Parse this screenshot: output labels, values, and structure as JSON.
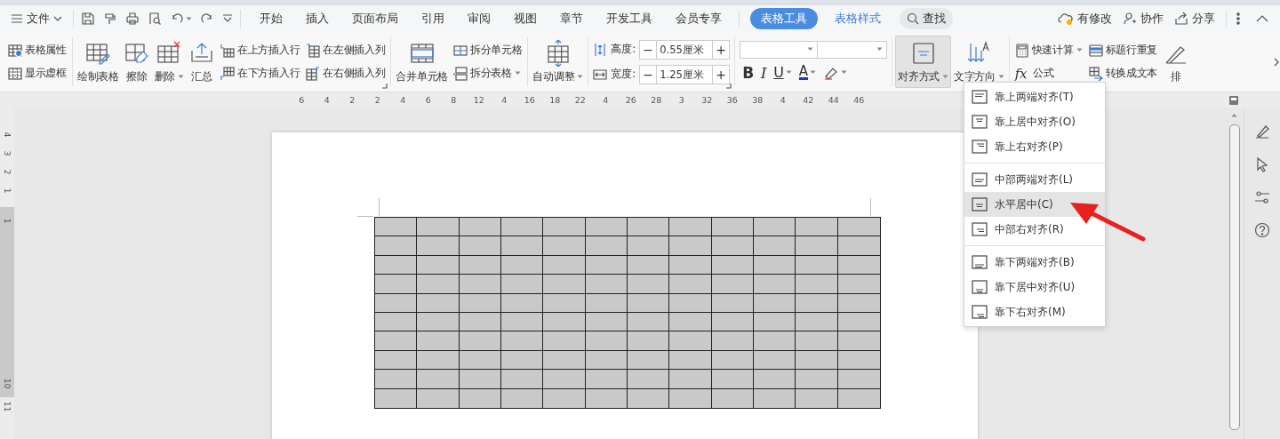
{
  "menu_bar": {
    "file_menu": {
      "label": "文件"
    },
    "tabs": [
      {
        "label": "开始",
        "kind": "normal",
        "selected": false
      },
      {
        "label": "插入",
        "kind": "normal",
        "selected": false
      },
      {
        "label": "页面布局",
        "kind": "normal",
        "selected": false
      },
      {
        "label": "引用",
        "kind": "normal",
        "selected": false
      },
      {
        "label": "审阅",
        "kind": "normal",
        "selected": false
      },
      {
        "label": "视图",
        "kind": "normal",
        "selected": false
      },
      {
        "label": "章节",
        "kind": "normal",
        "selected": false
      },
      {
        "label": "开发工具",
        "kind": "normal",
        "selected": false
      },
      {
        "label": "会员专享",
        "kind": "normal",
        "selected": false
      },
      {
        "label": "表格工具",
        "kind": "context",
        "selected": true
      },
      {
        "label": "表格样式",
        "kind": "context",
        "selected": false
      }
    ],
    "search": {
      "label": "查找"
    },
    "actions": [
      {
        "label": "有修改"
      },
      {
        "label": "协作"
      },
      {
        "label": "分享"
      }
    ]
  },
  "ribbon": {
    "groups": [
      {
        "launcher": false,
        "columns": [
          {
            "kind": "stack",
            "items": [
              {
                "label": "表格属性",
                "dropdown": false
              },
              {
                "label": "显示虚框",
                "dropdown": false
              }
            ]
          }
        ]
      },
      {
        "launcher": true,
        "columns": [
          {
            "kind": "large",
            "label": "绘制表格",
            "dropdown": false,
            "pressed": false
          },
          {
            "kind": "large",
            "label": "擦除",
            "dropdown": false,
            "pressed": false
          },
          {
            "kind": "large",
            "label": "删除",
            "dropdown": true,
            "pressed": false
          },
          {
            "kind": "large",
            "label": "汇总",
            "dropdown": false,
            "pressed": false
          },
          {
            "kind": "stack",
            "items": [
              {
                "label": "在上方插入行",
                "dropdown": false
              },
              {
                "label": "在下方插入行",
                "dropdown": false
              }
            ]
          },
          {
            "kind": "stack",
            "items": [
              {
                "label": "在左侧插入列",
                "dropdown": false
              },
              {
                "label": "在右侧插入列",
                "dropdown": false
              }
            ]
          }
        ]
      },
      {
        "launcher": false,
        "columns": [
          {
            "kind": "large",
            "label": "合并单元格",
            "dropdown": false,
            "pressed": false
          },
          {
            "kind": "stack",
            "items": [
              {
                "label": "拆分单元格",
                "dropdown": false
              },
              {
                "label": "拆分表格",
                "dropdown": true
              }
            ]
          }
        ]
      },
      {
        "launcher": false,
        "columns": [
          {
            "kind": "large",
            "label": "自动调整",
            "dropdown": true,
            "pressed": false
          }
        ]
      },
      {
        "launcher": true,
        "columns": [
          {
            "kind": "spinners",
            "items": [
              {
                "label": "高度:",
                "value": "0.55厘米",
                "decrement": "−",
                "increment": "+"
              },
              {
                "label": "宽度:",
                "value": "1.25厘米",
                "decrement": "−",
                "increment": "+"
              }
            ]
          }
        ]
      },
      {
        "launcher": false,
        "columns": [
          {
            "kind": "format",
            "items": [
              {
                "label": "B",
                "dropdown": false
              },
              {
                "label": "I",
                "dropdown": false
              },
              {
                "label": "U",
                "dropdown": true
              },
              {
                "label": "A",
                "dropdown": true
              },
              {
                "dropdown": true
              }
            ]
          }
        ]
      },
      {
        "launcher": false,
        "columns": [
          {
            "kind": "large",
            "label": "对齐方式",
            "dropdown": true,
            "pressed": true
          },
          {
            "kind": "large",
            "label": "文字方向",
            "dropdown": true,
            "pressed": false
          }
        ]
      },
      {
        "launcher": false,
        "columns": [
          {
            "kind": "stack",
            "items": [
              {
                "label": "快速计算",
                "dropdown": true
              },
              {
                "label": "公式",
                "symbol": "fx",
                "dropdown": false
              }
            ]
          },
          {
            "kind": "stack",
            "items": [
              {
                "label": "标题行重复",
                "dropdown": false
              },
              {
                "label": "转换成文本",
                "dropdown": false
              }
            ]
          },
          {
            "kind": "large",
            "label": "排",
            "dropdown": false,
            "pressed": false
          }
        ]
      }
    ]
  },
  "ruler": {
    "labels": [
      "6",
      "4",
      "2",
      "2",
      "4",
      "6",
      "8",
      "12",
      "4",
      "16",
      "18",
      "22",
      "4",
      "26",
      "28",
      "3",
      "32",
      "36",
      "38",
      "4",
      "42",
      "44",
      "46"
    ]
  },
  "vertical_ruler": {
    "labels": [
      {
        "text": "4",
        "shaded": false
      },
      {
        "text": "3",
        "shaded": false
      },
      {
        "text": "2",
        "shaded": false
      },
      {
        "text": "1",
        "shaded": false
      },
      {
        "text": "1",
        "shaded": true
      },
      {
        "text": "10",
        "shaded": true
      },
      {
        "text": "11",
        "shaded": false
      }
    ]
  },
  "table": {
    "rows": [
      {
        "selected": true
      },
      {
        "selected": true
      },
      {
        "selected": true
      },
      {
        "selected": true
      },
      {
        "selected": true
      },
      {
        "selected": true
      },
      {
        "selected": true
      },
      {
        "selected": true
      },
      {
        "selected": true
      },
      {
        "selected": true
      }
    ],
    "columns": [
      {
        "selected": true
      },
      {
        "selected": true
      },
      {
        "selected": true
      },
      {
        "selected": true
      },
      {
        "selected": true
      },
      {
        "selected": true
      },
      {
        "selected": true
      },
      {
        "selected": true
      },
      {
        "selected": true
      },
      {
        "selected": true
      },
      {
        "selected": true
      },
      {
        "selected": true
      }
    ]
  },
  "align_menu": {
    "sections": [
      [
        {
          "label": "靠上两端对齐(T)",
          "kind": "top-justify",
          "selected": false
        },
        {
          "label": "靠上居中对齐(O)",
          "kind": "top-center",
          "selected": false
        },
        {
          "label": "靠上右对齐(P)",
          "kind": "top-right",
          "selected": false
        }
      ],
      [
        {
          "label": "中部两端对齐(L)",
          "kind": "middle-justify",
          "selected": false
        },
        {
          "label": "水平居中(C)",
          "kind": "middle-center",
          "selected": true
        },
        {
          "label": "中部右对齐(R)",
          "kind": "middle-right",
          "selected": false
        }
      ],
      [
        {
          "label": "靠下两端对齐(B)",
          "kind": "bottom-justify",
          "selected": false
        },
        {
          "label": "靠下居中对齐(U)",
          "kind": "bottom-center",
          "selected": false
        },
        {
          "label": "靠下右对齐(M)",
          "kind": "bottom-right",
          "selected": false
        }
      ]
    ]
  }
}
